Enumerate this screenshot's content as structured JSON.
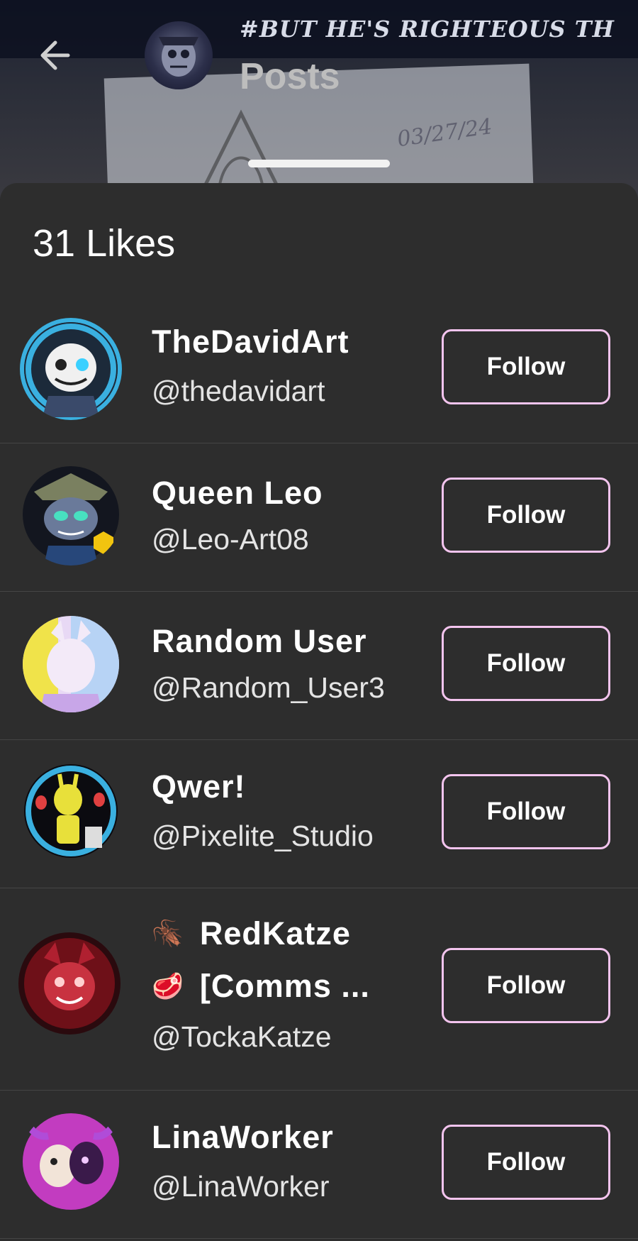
{
  "header": {
    "banner_text": "#BUT HE'S RIGHTEOUS TH",
    "title": "Posts",
    "background_date": "03/27/24"
  },
  "sheet": {
    "likes_label": "31 Likes"
  },
  "users": [
    {
      "name": "TheDavidArt",
      "handle": "@thedavidart",
      "button": "Follow"
    },
    {
      "name": "Queen Leo",
      "handle": "@Leo-Art08",
      "button": "Follow"
    },
    {
      "name": "Random User",
      "handle": "@Random_User3",
      "button": "Follow"
    },
    {
      "name": "Qwer!",
      "handle": "@Pixelite_Studio",
      "button": "Follow"
    },
    {
      "name_line1": "RedKatze",
      "name_line2": "[Comms ...",
      "emoji1": "🪳",
      "emoji2": "🥩",
      "handle": "@TockaKatze",
      "button": "Follow"
    },
    {
      "name": "LinaWorker",
      "handle": "@LinaWorker",
      "button": "Follow"
    }
  ],
  "colors": {
    "background": "#2d2d2d",
    "follow_border": "#f3c4ee",
    "divider": "#454545"
  }
}
